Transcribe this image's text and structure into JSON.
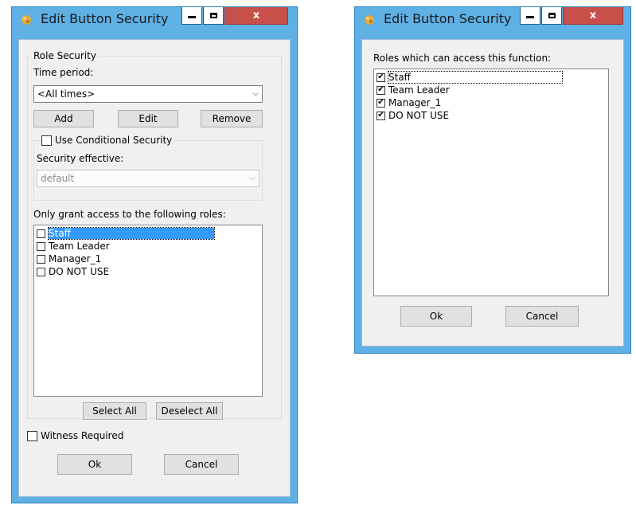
{
  "left_dialog": {
    "title": "Edit Button Security",
    "minimize_icon": "minimize-icon",
    "maximize_icon": "maximize-icon",
    "close_label": "x",
    "role_security_group": "Role Security",
    "time_period_label": "Time period:",
    "time_period_value": "<All times>",
    "add_label": "Add",
    "edit_label": "Edit",
    "remove_label": "Remove",
    "conditional_security_label": "Use Conditional Security",
    "conditional_security_checked": false,
    "security_effective_label": "Security effective:",
    "security_effective_value": "default",
    "roles_label": "Only grant access to the following roles:",
    "roles": [
      {
        "label": "Staff",
        "checked": false,
        "selected": true
      },
      {
        "label": "Team Leader",
        "checked": false
      },
      {
        "label": "Manager_1",
        "checked": false
      },
      {
        "label": "DO NOT USE",
        "checked": false
      }
    ],
    "select_all_label": "Select All",
    "deselect_all_label": "Deselect All",
    "witness_required_label": "Witness Required",
    "witness_required_checked": false,
    "ok_label": "Ok",
    "cancel_label": "Cancel"
  },
  "right_dialog": {
    "title": "Edit Button Security",
    "close_label": "x",
    "roles_label": "Roles which can access this function:",
    "roles": [
      {
        "label": "Staff",
        "checked": true,
        "focused": true
      },
      {
        "label": "Team Leader",
        "checked": true
      },
      {
        "label": "Manager_1",
        "checked": true
      },
      {
        "label": "DO NOT USE",
        "checked": true
      }
    ],
    "ok_label": "Ok",
    "cancel_label": "Cancel"
  },
  "colors": {
    "frame": "#5fb0e5",
    "client": "#f0f0f0",
    "close_button": "#c7504b",
    "selection": "#3399ff"
  }
}
